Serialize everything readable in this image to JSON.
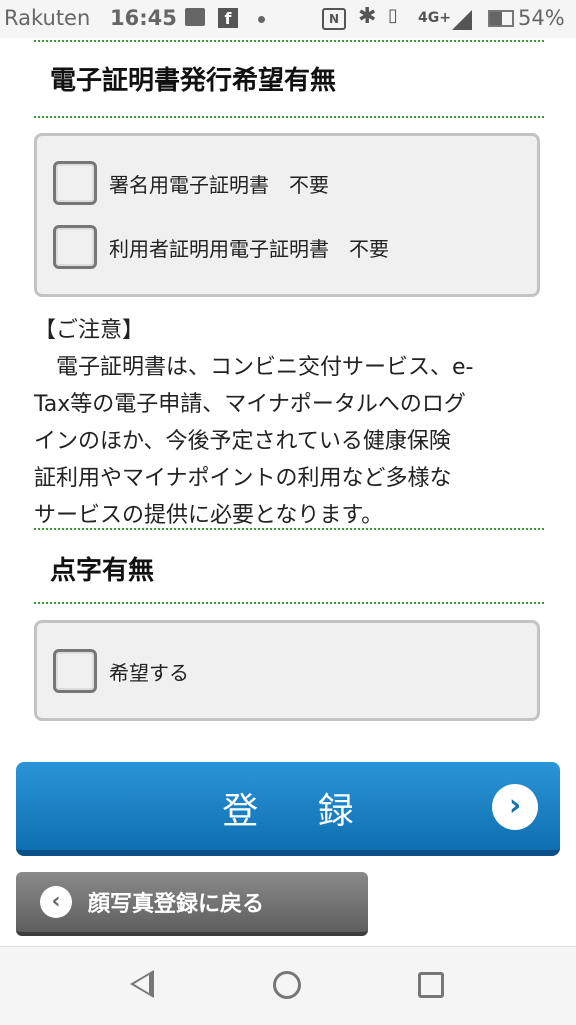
{
  "status_bar": {
    "carrier": "Rakuten",
    "time": "16:45",
    "network": "4G+",
    "battery": "54%"
  },
  "cert_section": {
    "title": "電子証明書発行希望有無",
    "options": [
      {
        "label": "署名用電子証明書　不要",
        "checked": false
      },
      {
        "label": "利用者証明用電子証明書　不要",
        "checked": false
      }
    ]
  },
  "notice": {
    "heading": "【ご注意】",
    "lines": [
      "　電子証明書は、コンビニ交付サービス、e-",
      "Tax等の電子申請、マイナポータルへのログ",
      "インのほか、今後予定されている健康保険",
      "証利用やマイナポイントの利用など多様な",
      "サービスの提供に必要となります。"
    ]
  },
  "braille_section": {
    "title": "点字有無",
    "options": [
      {
        "label": "希望する",
        "checked": false
      }
    ]
  },
  "buttons": {
    "register": "登 録",
    "register_icon": "chevron-right-icon",
    "back": "顔写真登録に戻る",
    "back_icon": "chevron-left-icon"
  },
  "colors": {
    "accent": "#1580c4",
    "divider": "#3a9a3a",
    "back_button": "#6e6e6e"
  }
}
